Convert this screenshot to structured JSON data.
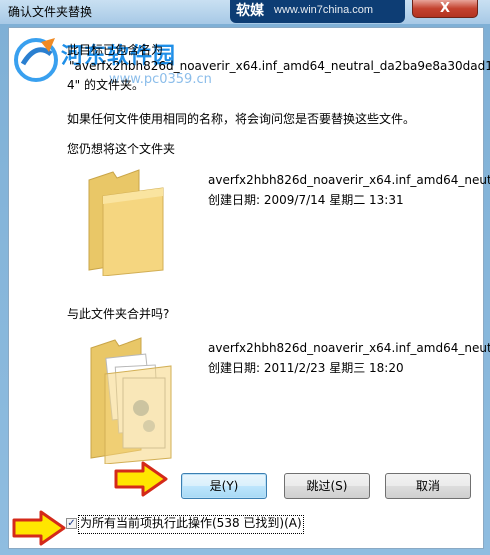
{
  "window": {
    "title": "确认文件夹替换",
    "close_label": "X",
    "watermark_brand": "软媒",
    "watermark_url": "www.win7china.com"
  },
  "watermark": {
    "site_name": "河东软件园",
    "site_url": "www.pc0359.cn"
  },
  "message": {
    "line1": "此目标已包含名为",
    "line2": "\"averfx2hbh826d_noaverir_x64.inf_amd64_neutral_da2ba9e8a30dad1",
    "line3": "4\" 的文件夹。",
    "line4": "如果任何文件使用相同的名称，将会询问您是否要替换这些文件。",
    "line5": "您仍想将这个文件夹"
  },
  "source_folder": {
    "name": "averfx2hbh826d_noaverir_x64.inf_amd64_neut...",
    "created": "创建日期: 2009/7/14 星期二 13:31"
  },
  "merge_prompt": "与此文件夹合并吗?",
  "target_folder": {
    "name": "averfx2hbh826d_noaverir_x64.inf_amd64_neut...",
    "created": "创建日期: 2011/2/23 星期三 18:20"
  },
  "buttons": {
    "yes": "是(Y)",
    "skip": "跳过(S)",
    "cancel": "取消"
  },
  "checkbox": {
    "checked": true,
    "label": "为所有当前项执行此操作(538 已找到)(A)"
  },
  "colors": {
    "folder": "#f5d680",
    "arrow_fill": "#ffe600",
    "arrow_stroke": "#d42a1a",
    "watermark_blue": "#1f8fe8"
  }
}
